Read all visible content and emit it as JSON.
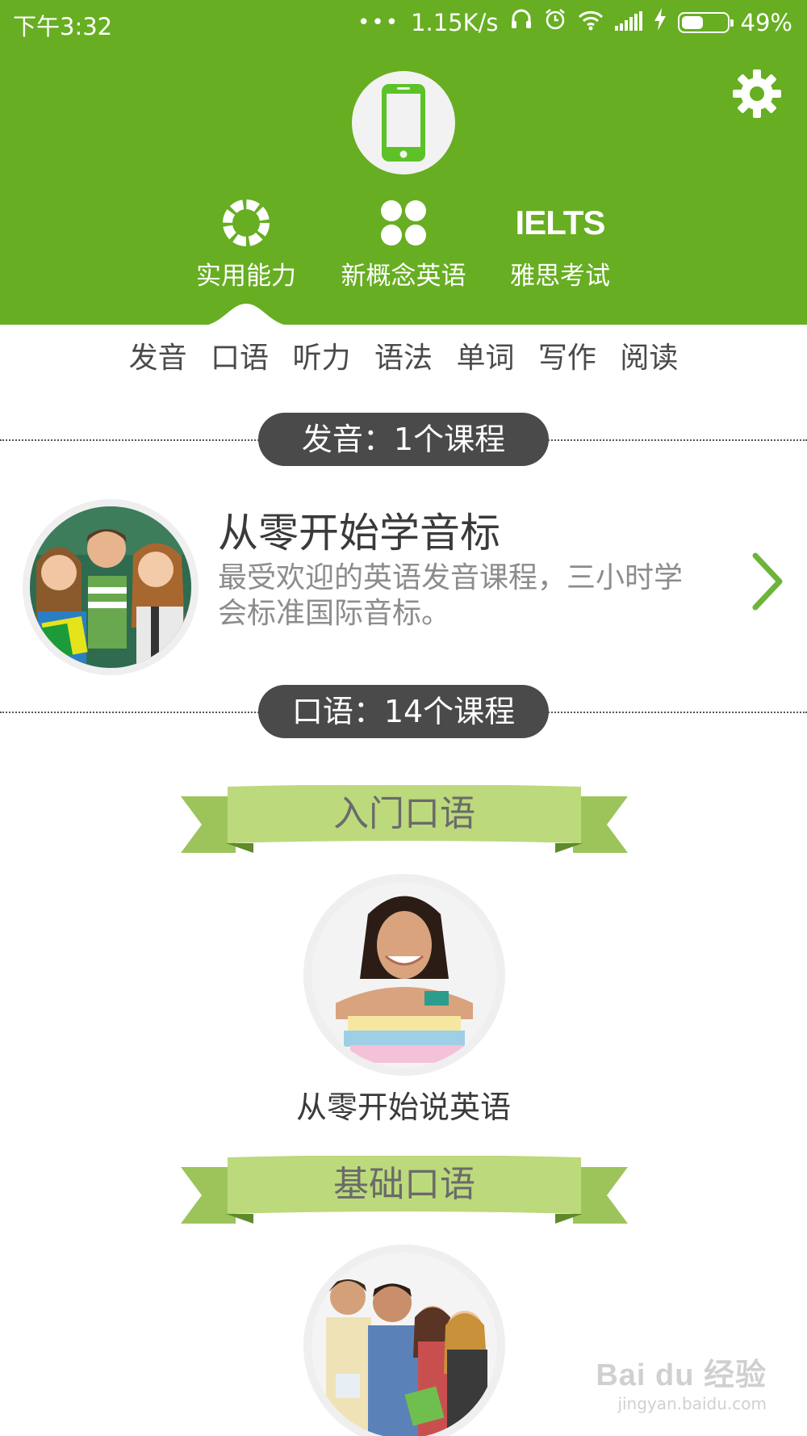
{
  "status_bar": {
    "time": "下午3:32",
    "dots": "•••",
    "speed": "1.15K/s",
    "battery": "49%",
    "battery_level": 0.49
  },
  "header": {
    "categories": [
      {
        "icon": "ring-icon",
        "label": "实用能力"
      },
      {
        "icon": "four-dots-icon",
        "label": "新概念英语"
      },
      {
        "icon": "ielts-logo-icon",
        "icon_text": "IELTS",
        "label": "雅思考试"
      }
    ],
    "selected_category": 0
  },
  "subnav": {
    "items": [
      "发音",
      "口语",
      "听力",
      "语法",
      "单词",
      "写作",
      "阅读"
    ]
  },
  "sections": [
    {
      "label": "发音：1个课程"
    },
    {
      "label": "口语：14个课程"
    }
  ],
  "pronunciation_course": {
    "title": "从零开始学音标",
    "description": "最受欢迎的英语发音课程，三小时学会标准国际音标。"
  },
  "speaking": {
    "levels": [
      {
        "ribbon": "入门口语",
        "course": "从零开始说英语"
      },
      {
        "ribbon": "基础口语",
        "course": ""
      }
    ]
  },
  "watermark": {
    "main": "Bai du 经验",
    "sub": "jingyan.baidu.com"
  },
  "colors": {
    "brand_green": "#67ae22",
    "ribbon_green": "#bcd97c",
    "pill_gray": "#4a4a4a"
  }
}
